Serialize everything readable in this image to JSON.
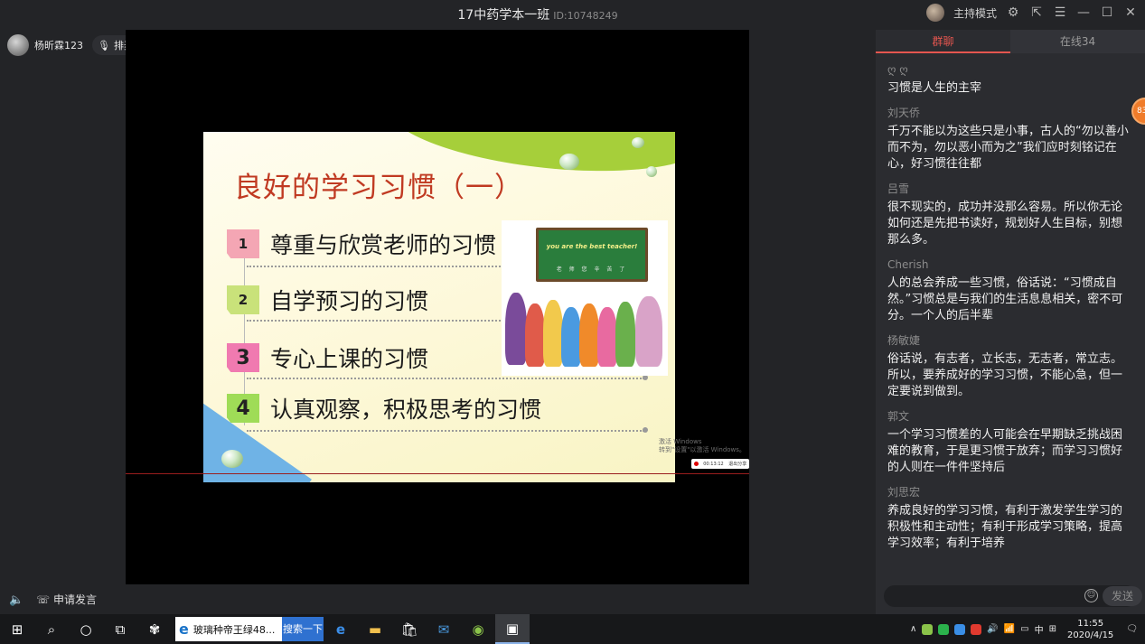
{
  "window": {
    "title": "17中药学本一班",
    "id_label": "ID:10748249",
    "host_mode": "主持模式"
  },
  "left_bar": {
    "user_name": "杨昕霖123",
    "queue_label": "排麦"
  },
  "slide": {
    "title": "良好的学习习惯（一）",
    "items": [
      {
        "num": "1",
        "text": "尊重与欣赏老师的习惯",
        "color": "#f4a6b4"
      },
      {
        "num": "2",
        "text": "自学预习的习惯",
        "color": "#c9e27a"
      },
      {
        "num": "3",
        "text": "专心上课的习惯",
        "color": "#f07ab0"
      },
      {
        "num": "4",
        "text": "认真观察，积极思考的习惯",
        "color": "#9fdc57"
      }
    ],
    "board_text": "you are the best teacher!",
    "board_sub": "老 师 您 辛 苦 了"
  },
  "stage": {
    "watermark_line1": "激活 Windows",
    "watermark_line2": "转到\"设置\"以激活 Windows。",
    "rec_time": "00:13:12",
    "rec_end": "退出分享"
  },
  "chat": {
    "tabs": [
      {
        "label": "群聊",
        "active": true
      },
      {
        "label": "在线34",
        "active": false
      }
    ],
    "unread_badge": "83",
    "messages": [
      {
        "name": "ღ ღ",
        "text": "习惯是人生的主宰"
      },
      {
        "name": "刘天侨",
        "text": "千万不能以为这些只是小事，古人的“勿以善小而不为，勿以恶小而为之”我们应时刻铭记在心，好习惯往往都"
      },
      {
        "name": "吕雪",
        "text": "很不现实的，成功并没那么容易。所以你无论如何还是先把书读好，规划好人生目标，别想那么多。"
      },
      {
        "name": "Cherish",
        "text": "人的总会养成一些习惯，俗话说：“习惯成自然。”习惯总是与我们的生活息息相关，密不可分。一个人的后半辈"
      },
      {
        "name": "杨敏婕",
        "text": "俗话说，有志者，立长志，无志者，常立志。所以，要养成好的学习习惯，不能心急，但一定要说到做到。"
      },
      {
        "name": "郭文",
        "text": "一个学习习惯差的人可能会在早期缺乏挑战困难的教育，于是更习惯于放弃；而学习习惯好的人则在一件件坚持后"
      },
      {
        "name": "刘思宏",
        "text": "养成良好的学习习惯，有利于激发学生学习的积极性和主动性；有利于形成学习策略，提高学习效率；有利于培养"
      }
    ],
    "send_label": "发送"
  },
  "bottom": {
    "apply_speak": "申请发言"
  },
  "taskbar": {
    "ie_label": "玻璃种帝王绿48...",
    "search_label": "搜索一下",
    "ime": "中",
    "time": "11:55",
    "date": "2020/4/15"
  }
}
